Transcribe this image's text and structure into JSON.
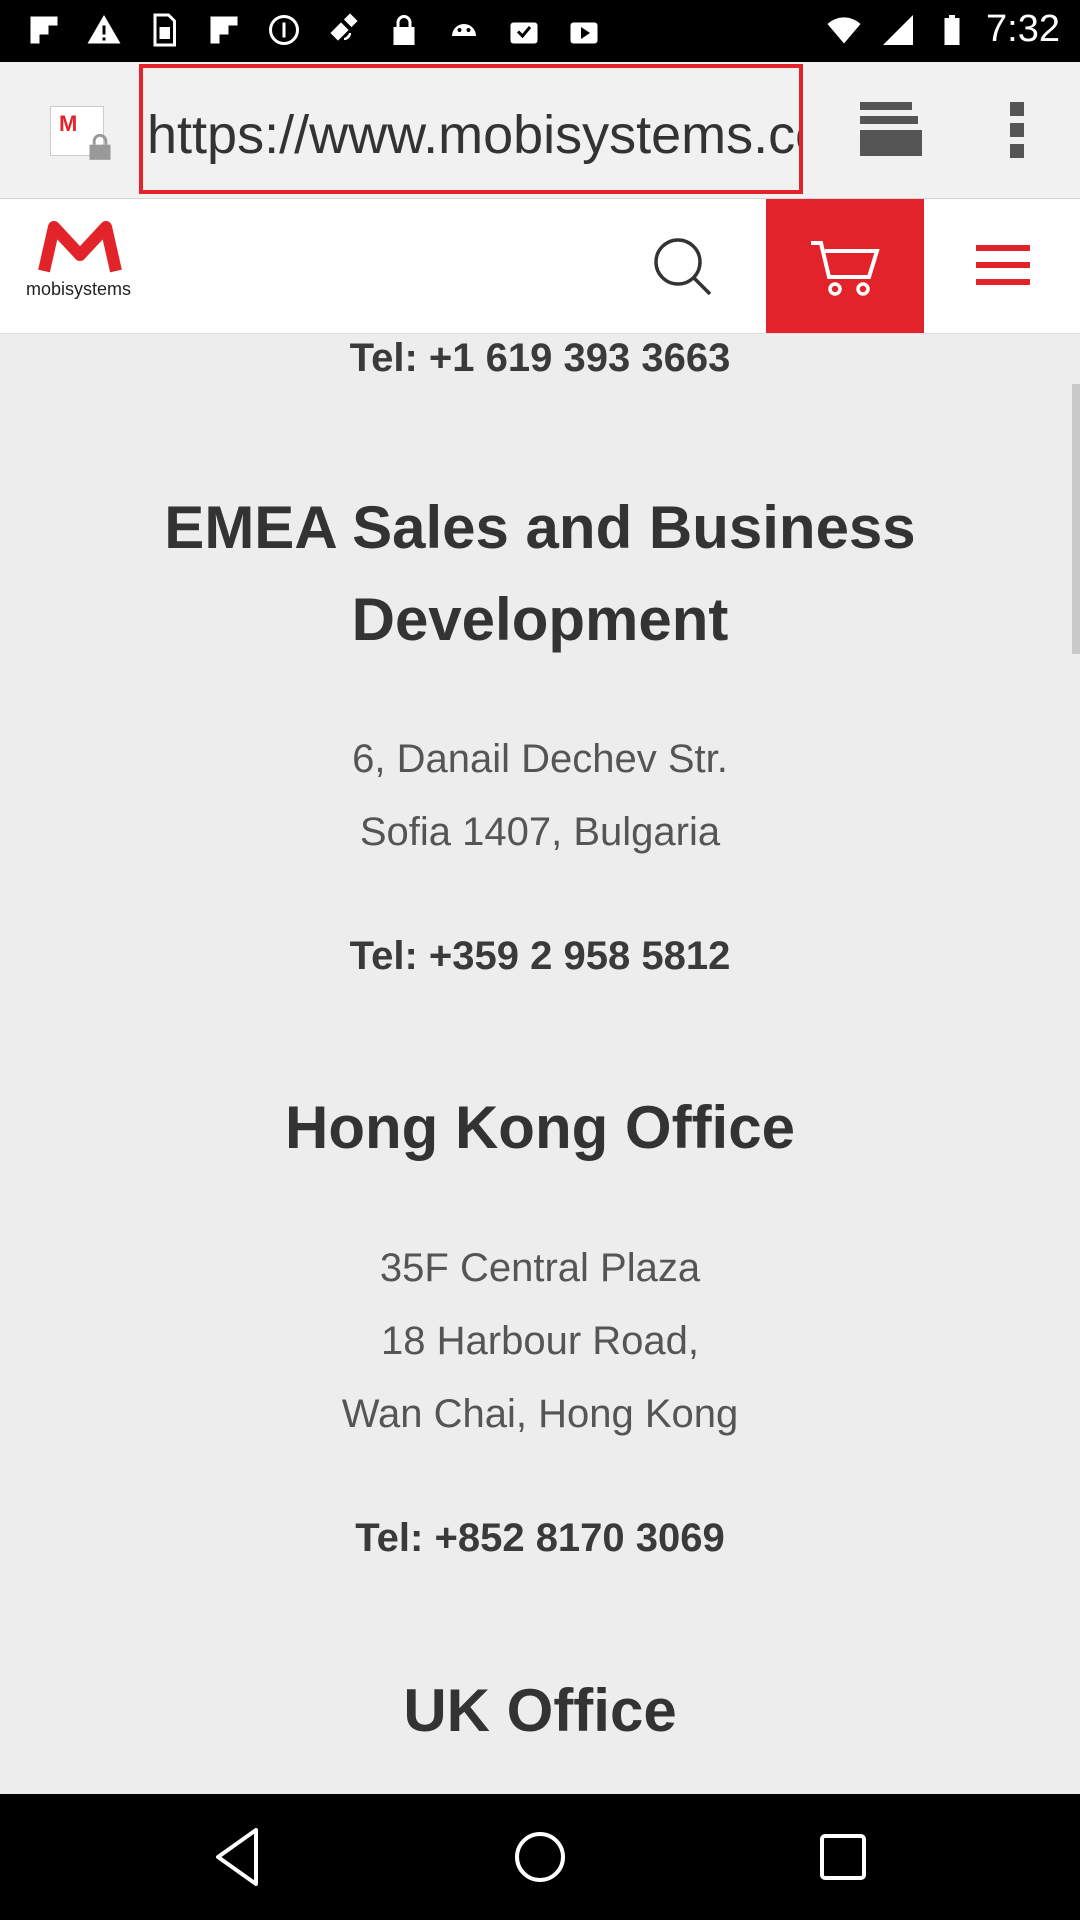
{
  "status_bar": {
    "time": "7:32",
    "icons": [
      "flipboard-icon",
      "warning-icon",
      "sim-icon",
      "flipboard-icon",
      "help-icon",
      "satellite-icon",
      "lock-icon",
      "android-icon",
      "clipboard-check-icon",
      "play-store-icon"
    ],
    "right_icons": [
      "wifi-icon",
      "signal-icon",
      "battery-icon"
    ]
  },
  "browser": {
    "url": "https://www.mobisystems.com/contact",
    "favicon": "mobisystems-favicon",
    "tabs_icon": "tabs-icon",
    "menu_icon": "overflow-menu-icon",
    "highlight_color": "#e3232a"
  },
  "site_header": {
    "logo_text": "mobisystems",
    "search_icon": "search-icon",
    "cart_icon": "cart-icon",
    "menu_icon": "hamburger-menu-icon",
    "brand_color": "#e3232a"
  },
  "content": {
    "us_tel": "Tel: +1 619 393 3663",
    "emea": {
      "heading_line1": "EMEA Sales and Business",
      "heading_line2": "Development",
      "address_line1": "6, Danail Dechev Str.",
      "address_line2": "Sofia 1407, Bulgaria",
      "tel": "Tel: +359 2 958 5812"
    },
    "hong_kong": {
      "heading": "Hong Kong Office",
      "address_line1": "35F Central Plaza",
      "address_line2": "18 Harbour Road,",
      "address_line3": "Wan Chai, Hong Kong",
      "tel": "Tel: +852 8170 3069"
    },
    "uk": {
      "heading": "UK Office"
    }
  },
  "nav_bar": {
    "back_icon": "back-icon",
    "home_icon": "home-icon",
    "recents_icon": "recents-icon"
  }
}
